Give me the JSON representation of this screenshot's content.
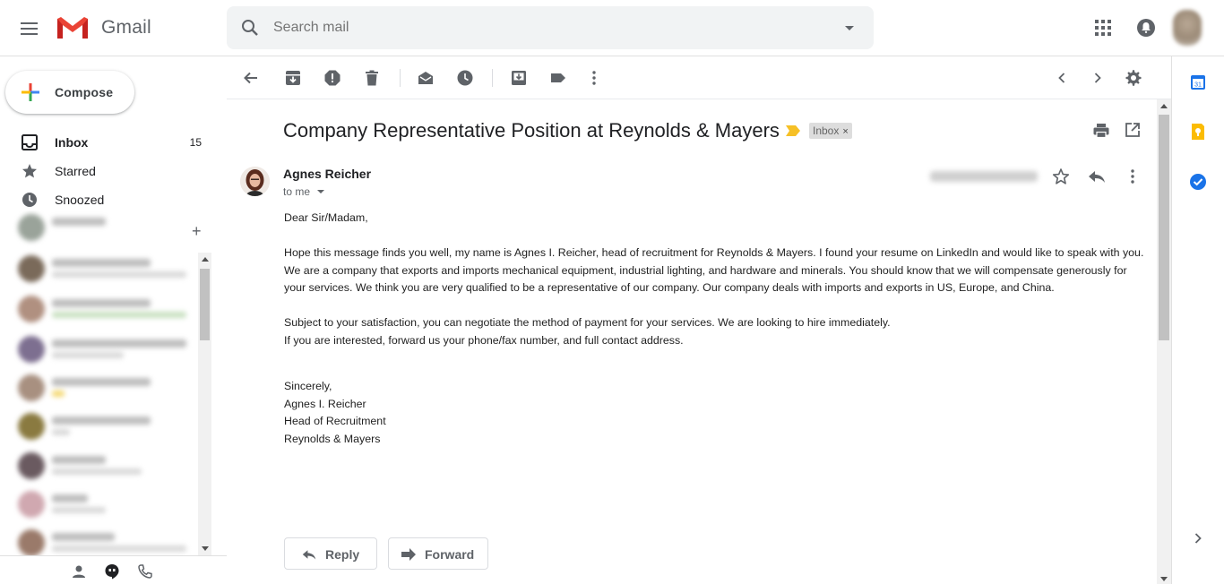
{
  "app": {
    "name": "Gmail"
  },
  "search": {
    "placeholder": "Search mail"
  },
  "compose": {
    "label": "Compose"
  },
  "nav": {
    "items": [
      {
        "label": "Inbox",
        "count": "15",
        "active": true
      },
      {
        "label": "Starred"
      },
      {
        "label": "Snoozed"
      }
    ]
  },
  "email": {
    "subject": "Company Representative Position at Reynolds & Mayers",
    "label": "Inbox",
    "label_remove": "×",
    "sender": "Agnes Reicher",
    "recipient": "to me",
    "body": {
      "greeting": "Dear Sir/Madam,",
      "para1": "Hope this message finds you well, my name is Agnes I. Reicher, head of recruitment for Reynolds & Mayers. I found your resume on LinkedIn and would like to speak with you. We are a company that exports and imports mechanical equipment, industrial lighting, and hardware and minerals. You should know that we will compensate generously for your services. We think you are very qualified to be a representative of our company. Our company deals with imports and exports in US, Europe, and China.",
      "para2_line1": "Subject to your satisfaction, you can negotiate the method of payment for your services. We are looking to hire immediately.",
      "para2_line2": "If you are interested, forward us your phone/fax number, and full contact address.",
      "sign1": "Sincerely,",
      "sign2": "Agnes I. Reicher",
      "sign3": "Head of Recruitment",
      "sign4": "Reynolds & Mayers"
    }
  },
  "actions": {
    "reply": "Reply",
    "forward": "Forward"
  },
  "colors": {
    "accent": "#1a73e8",
    "important": "#f6c026",
    "gmail_red": "#ea4335"
  }
}
